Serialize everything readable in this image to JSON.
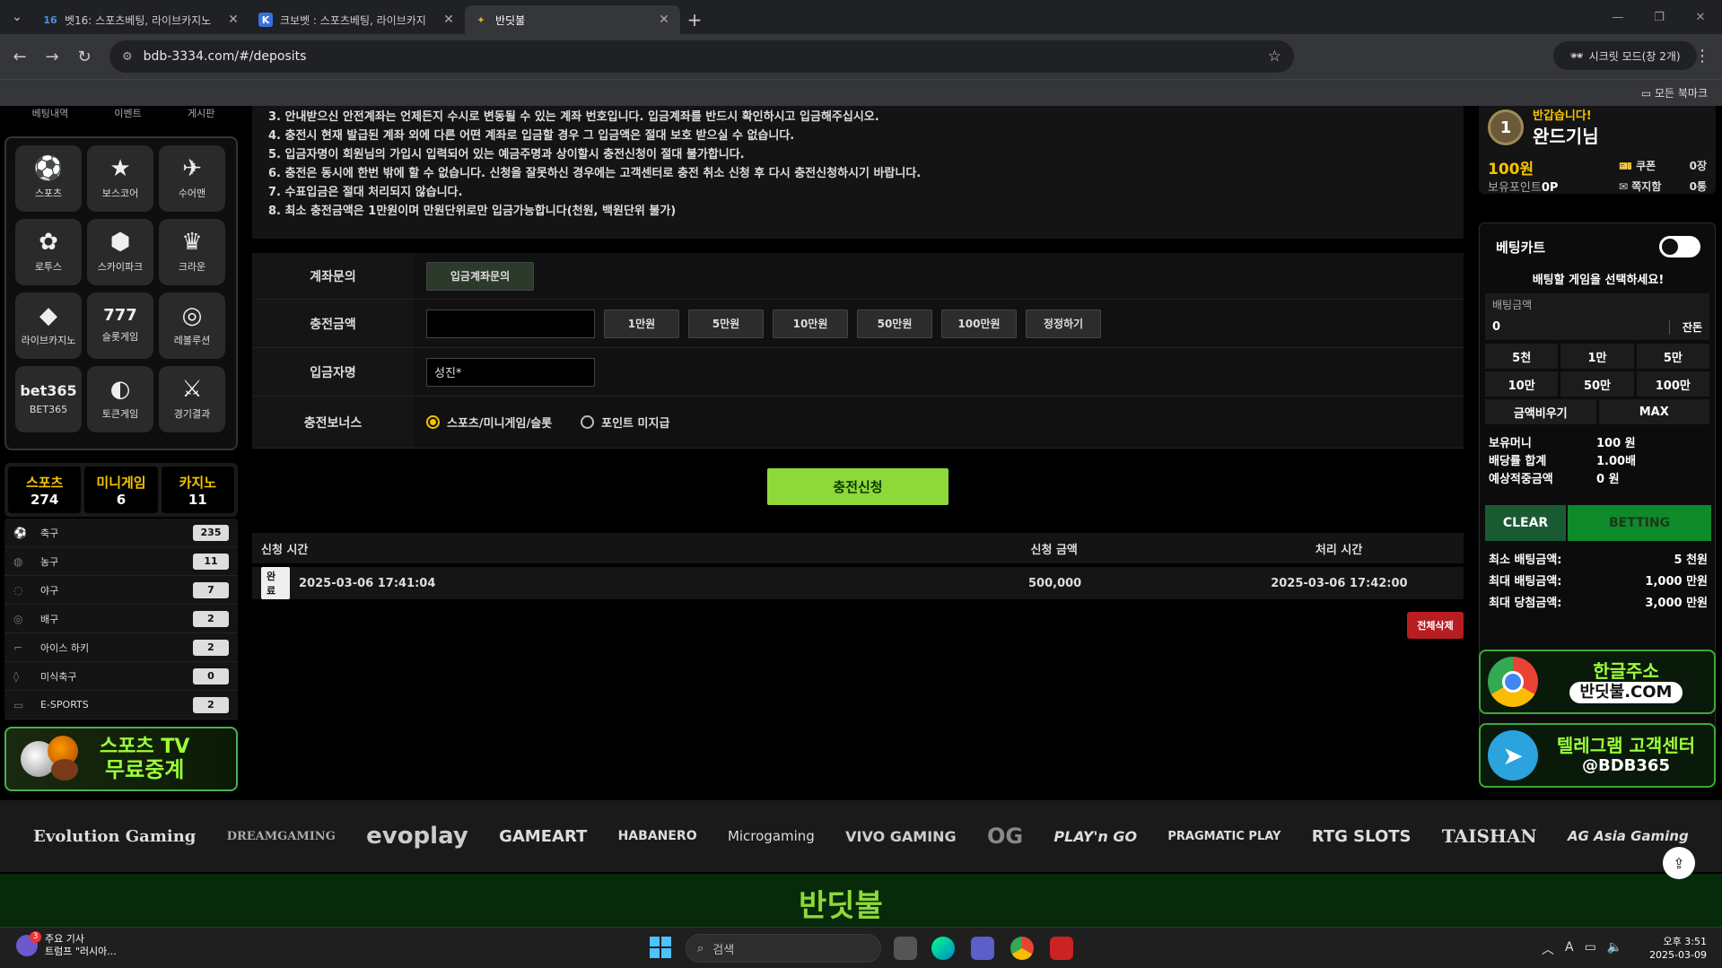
{
  "browser": {
    "tabs": [
      {
        "title": "벳16: 스포츠베팅, 라이브카지노",
        "fav": "16",
        "fav_color": "#4a90e2",
        "active": false
      },
      {
        "title": "크보벳 : 스포츠베팅, 라이브카지",
        "fav": "K",
        "fav_color": "#3a6fe0",
        "active": false
      },
      {
        "title": "반딧불",
        "fav": "✦",
        "fav_color": "#d4b82a",
        "active": true
      }
    ],
    "url": "bdb-3334.com/#/deposits",
    "incognito_label": "시크릿 모드(창 2개)",
    "bookmarks_label": "모든 북마크"
  },
  "sidebar": {
    "topnav": [
      "베팅내역",
      "이벤트",
      "게시판"
    ],
    "games": [
      {
        "label": "스포츠",
        "icon": "⚽"
      },
      {
        "label": "보스코어",
        "icon": "★"
      },
      {
        "label": "수어맨",
        "icon": "✈"
      },
      {
        "label": "로투스",
        "icon": "✿"
      },
      {
        "label": "스카이파크",
        "icon": "⬢"
      },
      {
        "label": "크라운",
        "icon": "♛"
      },
      {
        "label": "라이브카지노",
        "icon": "◆"
      },
      {
        "label": "슬롯게임",
        "icon": "777"
      },
      {
        "label": "레볼루션",
        "icon": "◎"
      },
      {
        "label": "BET365",
        "icon": "bet365"
      },
      {
        "label": "토큰게임",
        "icon": "◐"
      },
      {
        "label": "경기결과",
        "icon": "⚔"
      }
    ],
    "category_tabs": [
      {
        "name": "스포츠",
        "count": "274"
      },
      {
        "name": "미니게임",
        "count": "6"
      },
      {
        "name": "카지노",
        "count": "11"
      }
    ],
    "sports": [
      {
        "name": "축구",
        "count": "235",
        "icon": "⚽"
      },
      {
        "name": "농구",
        "count": "11",
        "icon": "◍"
      },
      {
        "name": "야구",
        "count": "7",
        "icon": "◌"
      },
      {
        "name": "배구",
        "count": "2",
        "icon": "◎"
      },
      {
        "name": "아이스 하키",
        "count": "2",
        "icon": "⌐"
      },
      {
        "name": "미식축구",
        "count": "0",
        "icon": "◊"
      },
      {
        "name": "E-SPORTS",
        "count": "2",
        "icon": "▭"
      }
    ],
    "tv_banner": {
      "line1": "스포츠 TV",
      "line2": "무료중계"
    }
  },
  "notice": [
    "3. 안내받으신 안전계좌는 언제든지 수시로 변동될 수 있는 계좌 번호입니다. 입금계좌를 반드시 확인하시고 입금해주십시오.",
    "4. 충전시 현재 발급된 계좌 외에 다른 어떤 계좌로 입금할 경우 그 입금액은 절대 보호 받으실 수 없습니다.",
    "5. 입금자명이 회원님의 가입시 입력되어 있는 예금주명과 상이할시 충전신청이 절대 불가합니다.",
    "6. 충전은 동시에 한번 밖에 할 수 없습니다. 신청을 잘못하신 경우에는 고객센터로 충전 취소 신청 후 다시 충전신청하시기 바랍니다.",
    "7. 수표입금은 절대 처리되지 않습니다.",
    "8. 최소 충전금액은 1만원이며 만원단위로만 입금가능합니다(천원, 백원단위 불가)"
  ],
  "form": {
    "account_label": "계좌문의",
    "account_btn": "입금계좌문의",
    "amount_label": "충전금액",
    "amount_value": "",
    "amount_buttons": [
      "1만원",
      "5만원",
      "10만원",
      "50만원",
      "100만원",
      "정정하기"
    ],
    "depositor_label": "입금자명",
    "depositor_value": "성진*",
    "bonus_label": "충전보너스",
    "bonus_options": [
      {
        "label": "스포츠/미니게임/슬롯",
        "selected": true
      },
      {
        "label": "포인트 미지급",
        "selected": false
      }
    ],
    "submit": "충전신청"
  },
  "history": {
    "headers": {
      "time": "신청 시간",
      "amount": "신청 금액",
      "processed": "처리 시간"
    },
    "rows": [
      {
        "status": "완료",
        "time": "2025-03-06 17:41:04",
        "amount": "500,000",
        "processed": "2025-03-06 17:42:00"
      }
    ],
    "delete_all": "전체삭제"
  },
  "user": {
    "level": "1",
    "greeting": "반갑습니다!",
    "name": "완드기님",
    "money": "100원",
    "points_label": "보유포인트",
    "points_value": "0P",
    "coupon_label": "쿠폰",
    "coupon_value": "0장",
    "message_label": "쪽지함",
    "message_value": "0통"
  },
  "betcart": {
    "title": "베팅카트",
    "select_prompt": "배팅할 게임을 선택하세요!",
    "amount_label": "배팅금액",
    "amount_value": "0",
    "balance_btn": "잔돈",
    "chips": [
      "5천",
      "1만",
      "5만",
      "10만",
      "50만",
      "100만"
    ],
    "clear_amount": "금액비우기",
    "max": "MAX",
    "info": [
      {
        "k": "보유머니",
        "v": "100 원"
      },
      {
        "k": "배당률 합계",
        "v": "1.00배"
      },
      {
        "k": "예상적중금액",
        "v": "0 원"
      }
    ],
    "clear_btn": "CLEAR",
    "bet_btn": "BETTING",
    "limits": [
      {
        "k": "최소 배팅금액:",
        "v": "5 천원"
      },
      {
        "k": "최대 배팅금액:",
        "v": "1,000 만원"
      },
      {
        "k": "최대 당첨금액:",
        "v": "3,000 만원"
      }
    ]
  },
  "banners": {
    "domain_title": "한글주소",
    "domain_value": "반딧불.COM",
    "telegram_title": "텔레그램 고객센터",
    "telegram_value": "@BDB365"
  },
  "providers": [
    "Evolution Gaming",
    "DREAMGAMING",
    "evoplay",
    "GAMEART",
    "HABANERO",
    "Microgaming",
    "VIVO GAMING",
    "OG",
    "PLAY'n GO",
    "PRAGMATIC PLAY",
    "RTG SLOTS",
    "TAISHAN",
    "AG Asia Gaming"
  ],
  "footer": {
    "logo": "반딧불"
  },
  "taskbar": {
    "news_title": "주요 기사",
    "news_sub": "트럼프 \"러시아...",
    "search_placeholder": "검색",
    "time": "오후 3:51",
    "date": "2025-03-09"
  }
}
